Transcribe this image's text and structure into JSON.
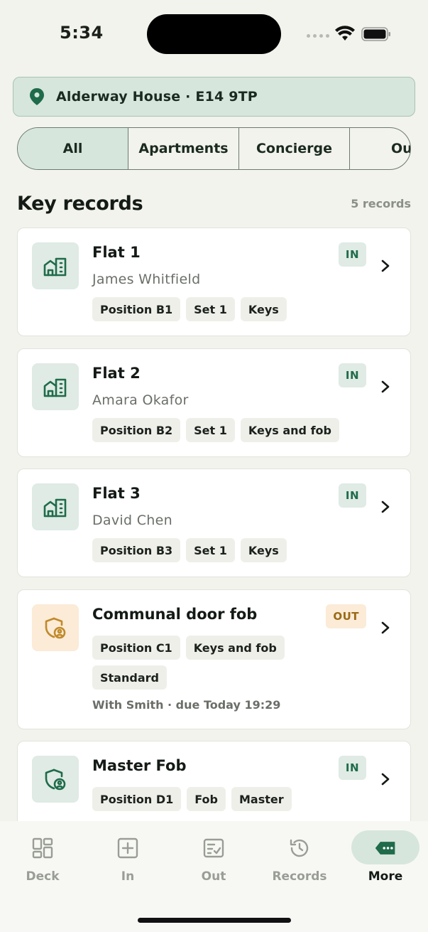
{
  "status_bar": {
    "time": "5:34"
  },
  "location": {
    "text": "Alderway House · E14 9TP"
  },
  "tabs": [
    {
      "label": "All",
      "active": true
    },
    {
      "label": "Apartments",
      "active": false
    },
    {
      "label": "Concierge",
      "active": false
    },
    {
      "label": "Ou",
      "active": false
    }
  ],
  "section": {
    "title": "Key records",
    "count": "5 records"
  },
  "records": [
    {
      "title": "Flat 1",
      "subtitle": "James Whitfield",
      "status": "IN",
      "icon": "building-icon",
      "chips": [
        "Position B1",
        "Set 1",
        "Keys"
      ]
    },
    {
      "title": "Flat 2",
      "subtitle": "Amara Okafor",
      "status": "IN",
      "icon": "building-icon",
      "chips": [
        "Position B2",
        "Set 1",
        "Keys and fob"
      ]
    },
    {
      "title": "Flat 3",
      "subtitle": "David Chen",
      "status": "IN",
      "icon": "building-icon",
      "chips": [
        "Position B3",
        "Set 1",
        "Keys"
      ]
    },
    {
      "title": "Communal door fob",
      "status": "OUT",
      "icon": "shield-user-icon",
      "chips": [
        "Position C1",
        "Keys and fob",
        "Standard"
      ],
      "note": "With Smith · due Today 19:29"
    },
    {
      "title": "Master Fob",
      "status": "IN",
      "icon": "shield-user-icon",
      "chips": [
        "Position D1",
        "Fob",
        "Master"
      ]
    }
  ],
  "nav": [
    {
      "label": "Deck",
      "icon": "grid-icon",
      "active": false
    },
    {
      "label": "In",
      "icon": "plus-square-icon",
      "active": false
    },
    {
      "label": "Out",
      "icon": "checklist-icon",
      "active": false
    },
    {
      "label": "Records",
      "icon": "history-icon",
      "active": false
    },
    {
      "label": "More",
      "icon": "more-tag-icon",
      "active": true
    }
  ],
  "colors": {
    "accent": "#1f6b4a",
    "accent_bg": "#d6e6dc",
    "out_text": "#9a6a16",
    "out_bg": "#fbebd7",
    "background": "#f1f3ec"
  }
}
